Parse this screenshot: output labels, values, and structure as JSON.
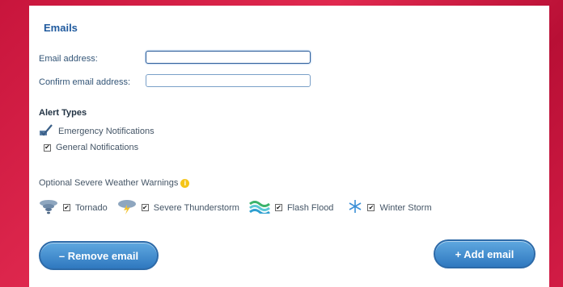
{
  "section_title": "Emails",
  "email_address": {
    "label": "Email address:",
    "value": ""
  },
  "confirm_email": {
    "label": "Confirm email address:",
    "value": ""
  },
  "alert_types": {
    "heading": "Alert Types",
    "items": [
      {
        "label": "Emergency Notifications",
        "checked": true,
        "icon": "check-edit-icon"
      },
      {
        "label": "General Notifications",
        "checked": true
      }
    ]
  },
  "weather": {
    "heading": "Optional Severe Weather Warnings",
    "info_icon": "info-icon",
    "items": [
      {
        "label": "Tornado",
        "checked": true,
        "icon": "tornado-icon"
      },
      {
        "label": "Severe Thunderstorm",
        "checked": true,
        "icon": "thunderstorm-icon"
      },
      {
        "label": "Flash Flood",
        "checked": true,
        "icon": "flash-flood-icon"
      },
      {
        "label": "Winter Storm",
        "checked": true,
        "icon": "snowflake-icon"
      }
    ]
  },
  "buttons": {
    "remove": "– Remove email",
    "add": "+ Add email"
  },
  "colors": {
    "accent": "#1f5a9e",
    "background": "#d21c45",
    "button": "#2f78bf"
  }
}
